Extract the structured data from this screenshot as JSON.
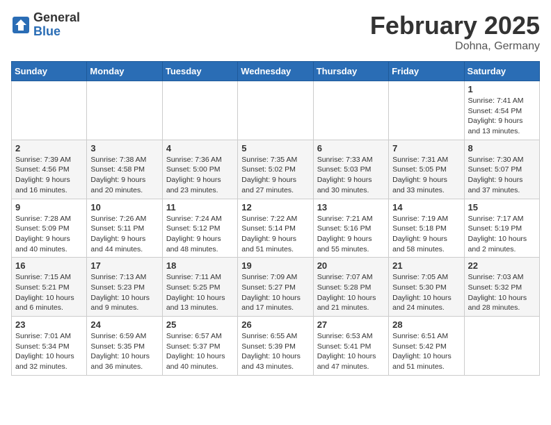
{
  "logo": {
    "general": "General",
    "blue": "Blue"
  },
  "header": {
    "month": "February 2025",
    "location": "Dohna, Germany"
  },
  "weekdays": [
    "Sunday",
    "Monday",
    "Tuesday",
    "Wednesday",
    "Thursday",
    "Friday",
    "Saturday"
  ],
  "weeks": [
    [
      {
        "day": "",
        "info": ""
      },
      {
        "day": "",
        "info": ""
      },
      {
        "day": "",
        "info": ""
      },
      {
        "day": "",
        "info": ""
      },
      {
        "day": "",
        "info": ""
      },
      {
        "day": "",
        "info": ""
      },
      {
        "day": "1",
        "info": "Sunrise: 7:41 AM\nSunset: 4:54 PM\nDaylight: 9 hours and 13 minutes."
      }
    ],
    [
      {
        "day": "2",
        "info": "Sunrise: 7:39 AM\nSunset: 4:56 PM\nDaylight: 9 hours and 16 minutes."
      },
      {
        "day": "3",
        "info": "Sunrise: 7:38 AM\nSunset: 4:58 PM\nDaylight: 9 hours and 20 minutes."
      },
      {
        "day": "4",
        "info": "Sunrise: 7:36 AM\nSunset: 5:00 PM\nDaylight: 9 hours and 23 minutes."
      },
      {
        "day": "5",
        "info": "Sunrise: 7:35 AM\nSunset: 5:02 PM\nDaylight: 9 hours and 27 minutes."
      },
      {
        "day": "6",
        "info": "Sunrise: 7:33 AM\nSunset: 5:03 PM\nDaylight: 9 hours and 30 minutes."
      },
      {
        "day": "7",
        "info": "Sunrise: 7:31 AM\nSunset: 5:05 PM\nDaylight: 9 hours and 33 minutes."
      },
      {
        "day": "8",
        "info": "Sunrise: 7:30 AM\nSunset: 5:07 PM\nDaylight: 9 hours and 37 minutes."
      }
    ],
    [
      {
        "day": "9",
        "info": "Sunrise: 7:28 AM\nSunset: 5:09 PM\nDaylight: 9 hours and 40 minutes."
      },
      {
        "day": "10",
        "info": "Sunrise: 7:26 AM\nSunset: 5:11 PM\nDaylight: 9 hours and 44 minutes."
      },
      {
        "day": "11",
        "info": "Sunrise: 7:24 AM\nSunset: 5:12 PM\nDaylight: 9 hours and 48 minutes."
      },
      {
        "day": "12",
        "info": "Sunrise: 7:22 AM\nSunset: 5:14 PM\nDaylight: 9 hours and 51 minutes."
      },
      {
        "day": "13",
        "info": "Sunrise: 7:21 AM\nSunset: 5:16 PM\nDaylight: 9 hours and 55 minutes."
      },
      {
        "day": "14",
        "info": "Sunrise: 7:19 AM\nSunset: 5:18 PM\nDaylight: 9 hours and 58 minutes."
      },
      {
        "day": "15",
        "info": "Sunrise: 7:17 AM\nSunset: 5:19 PM\nDaylight: 10 hours and 2 minutes."
      }
    ],
    [
      {
        "day": "16",
        "info": "Sunrise: 7:15 AM\nSunset: 5:21 PM\nDaylight: 10 hours and 6 minutes."
      },
      {
        "day": "17",
        "info": "Sunrise: 7:13 AM\nSunset: 5:23 PM\nDaylight: 10 hours and 9 minutes."
      },
      {
        "day": "18",
        "info": "Sunrise: 7:11 AM\nSunset: 5:25 PM\nDaylight: 10 hours and 13 minutes."
      },
      {
        "day": "19",
        "info": "Sunrise: 7:09 AM\nSunset: 5:27 PM\nDaylight: 10 hours and 17 minutes."
      },
      {
        "day": "20",
        "info": "Sunrise: 7:07 AM\nSunset: 5:28 PM\nDaylight: 10 hours and 21 minutes."
      },
      {
        "day": "21",
        "info": "Sunrise: 7:05 AM\nSunset: 5:30 PM\nDaylight: 10 hours and 24 minutes."
      },
      {
        "day": "22",
        "info": "Sunrise: 7:03 AM\nSunset: 5:32 PM\nDaylight: 10 hours and 28 minutes."
      }
    ],
    [
      {
        "day": "23",
        "info": "Sunrise: 7:01 AM\nSunset: 5:34 PM\nDaylight: 10 hours and 32 minutes."
      },
      {
        "day": "24",
        "info": "Sunrise: 6:59 AM\nSunset: 5:35 PM\nDaylight: 10 hours and 36 minutes."
      },
      {
        "day": "25",
        "info": "Sunrise: 6:57 AM\nSunset: 5:37 PM\nDaylight: 10 hours and 40 minutes."
      },
      {
        "day": "26",
        "info": "Sunrise: 6:55 AM\nSunset: 5:39 PM\nDaylight: 10 hours and 43 minutes."
      },
      {
        "day": "27",
        "info": "Sunrise: 6:53 AM\nSunset: 5:41 PM\nDaylight: 10 hours and 47 minutes."
      },
      {
        "day": "28",
        "info": "Sunrise: 6:51 AM\nSunset: 5:42 PM\nDaylight: 10 hours and 51 minutes."
      },
      {
        "day": "",
        "info": ""
      }
    ]
  ]
}
